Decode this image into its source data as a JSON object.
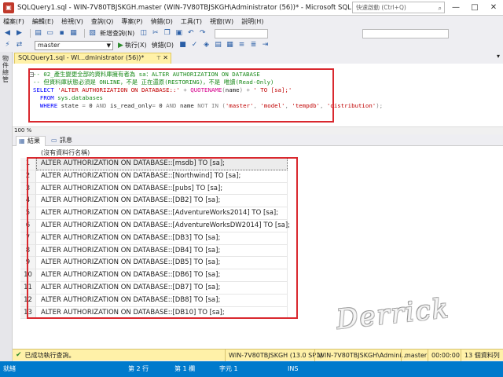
{
  "window": {
    "title": "SQLQuery1.sql - WIN-7V80TBJSKGH.master (WIN-7V80TBJSKGH\\Administrator (56))* - Microsoft SQL Server Manage...",
    "quick_launch_placeholder": "快速啟動 (Ctrl+Q)",
    "controls": [
      "—",
      "□",
      "✕"
    ]
  },
  "menu": [
    "檔案(F)",
    "編輯(E)",
    "檢視(V)",
    "查詢(Q)",
    "專案(P)",
    "偵錯(D)",
    "工具(T)",
    "視窗(W)",
    "說明(H)"
  ],
  "toolbar1": {
    "new_query_label": "新增查詢(N)"
  },
  "toolbar2": {
    "database": "master",
    "execute_label": "執行(X)",
    "debug_label": "偵錯(D)"
  },
  "left_rail": {
    "label": "物件總管"
  },
  "document_tab": {
    "label": "SQLQuery1.sql - WI...dministrator (56))*"
  },
  "editor": {
    "zoom": "100 %",
    "lines": [
      [
        {
          "t": "-- 02_產生變更全部的資料庫擁有者為 sa：ALTER AUTHORIZATION ON DATABASE",
          "c": "c-com"
        }
      ],
      [
        {
          "t": "-- 但資料庫狀態必須是 ONLINE，不是 正在還原(RESTORING)，不是 唯讀(Read-Only)",
          "c": "c-com"
        }
      ],
      [
        {
          "t": "SELECT ",
          "c": "c-kw"
        },
        {
          "t": "'ALTER AUTHORIZATION ON DATABASE::'",
          "c": "c-str"
        },
        {
          "t": " + ",
          "c": "c-op"
        },
        {
          "t": "QUOTENAME",
          "c": "c-fn"
        },
        {
          "t": "(",
          "c": "c-op"
        },
        {
          "t": "name",
          "c": ""
        },
        {
          "t": ") + ",
          "c": "c-op"
        },
        {
          "t": "' TO [sa];'",
          "c": "c-str"
        }
      ],
      [
        {
          "t": "  FROM ",
          "c": "c-kw"
        },
        {
          "t": "sys.databases",
          "c": "c-sys"
        }
      ],
      [
        {
          "t": "  WHERE ",
          "c": "c-kw"
        },
        {
          "t": "state ",
          "c": ""
        },
        {
          "t": "= ",
          "c": "c-op"
        },
        {
          "t": "0 ",
          "c": ""
        },
        {
          "t": "AND ",
          "c": "c-op"
        },
        {
          "t": "is_read_only",
          "c": ""
        },
        {
          "t": "= ",
          "c": "c-op"
        },
        {
          "t": "0 ",
          "c": ""
        },
        {
          "t": "AND ",
          "c": "c-op"
        },
        {
          "t": "name ",
          "c": ""
        },
        {
          "t": "NOT IN ",
          "c": "c-op"
        },
        {
          "t": "(",
          "c": "c-op"
        },
        {
          "t": "'master'",
          "c": "c-str"
        },
        {
          "t": ", ",
          "c": "c-op"
        },
        {
          "t": "'model'",
          "c": "c-str"
        },
        {
          "t": ", ",
          "c": "c-op"
        },
        {
          "t": "'tempdb'",
          "c": "c-str"
        },
        {
          "t": ", ",
          "c": "c-op"
        },
        {
          "t": "'distribution'",
          "c": "c-str"
        },
        {
          "t": ");",
          "c": "c-op"
        }
      ]
    ]
  },
  "results_tabs": {
    "grid": "結果",
    "messages": "訊息"
  },
  "results": {
    "column_header": "(沒有資料行名稱)",
    "rows": [
      {
        "n": "1",
        "v": "ALTER AUTHORIZATION ON DATABASE::[msdb] TO [sa];"
      },
      {
        "n": "2",
        "v": "ALTER AUTHORIZATION ON DATABASE::[Northwind] TO [sa];"
      },
      {
        "n": "3",
        "v": "ALTER AUTHORIZATION ON DATABASE::[pubs] TO [sa];"
      },
      {
        "n": "4",
        "v": "ALTER AUTHORIZATION ON DATABASE::[DB2] TO [sa];"
      },
      {
        "n": "5",
        "v": "ALTER AUTHORIZATION ON DATABASE::[AdventureWorks2014] TO [sa];"
      },
      {
        "n": "6",
        "v": "ALTER AUTHORIZATION ON DATABASE::[AdventureWorksDW2014] TO [sa];"
      },
      {
        "n": "7",
        "v": "ALTER AUTHORIZATION ON DATABASE::[DB3] TO [sa];"
      },
      {
        "n": "8",
        "v": "ALTER AUTHORIZATION ON DATABASE::[DB4] TO [sa];"
      },
      {
        "n": "9",
        "v": "ALTER AUTHORIZATION ON DATABASE::[DB5] TO [sa];"
      },
      {
        "n": "10",
        "v": "ALTER AUTHORIZATION ON DATABASE::[DB6] TO [sa];"
      },
      {
        "n": "11",
        "v": "ALTER AUTHORIZATION ON DATABASE::[DB7] TO [sa];"
      },
      {
        "n": "12",
        "v": "ALTER AUTHORIZATION ON DATABASE::[DB8] TO [sa];"
      },
      {
        "n": "13",
        "v": "ALTER AUTHORIZATION ON DATABASE::[DB10] TO [sa];"
      }
    ]
  },
  "watermark": "Derrick",
  "query_status": {
    "message": "已成功執行查詢。",
    "server": "WIN-7V80TBJSKGH (13.0 SP1)",
    "user": "WIN-7V80TBJSKGH\\Admini...",
    "database": "master",
    "elapsed": "00:00:00",
    "rows": "13 個資料列"
  },
  "statusbar": {
    "state": "就緒",
    "line": "第 2 行",
    "col": "第 1 欄",
    "char": "字元 1",
    "mode": "INS"
  },
  "colors": {
    "statusbar": "#007acc",
    "highlight_box": "#d9282e",
    "tab_active": "#fff1a8"
  }
}
